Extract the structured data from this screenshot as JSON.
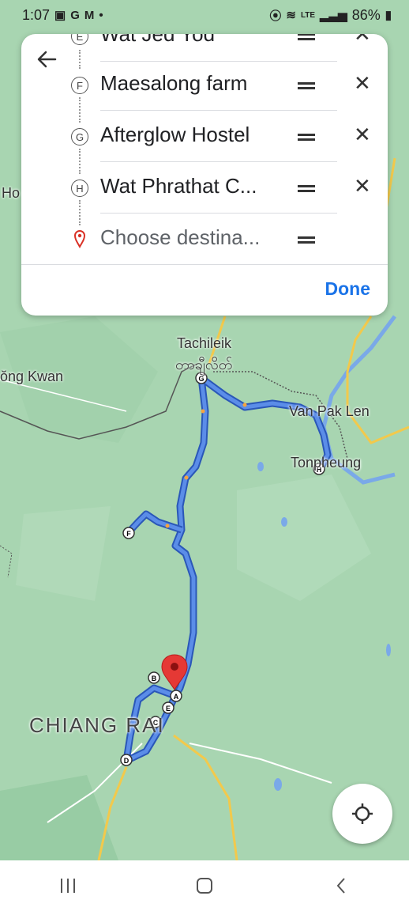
{
  "status_bar": {
    "time": "1:07",
    "battery": "86%",
    "network": "LTE"
  },
  "stops": [
    {
      "letter": "E",
      "name": "Wat Jed Yod",
      "remove": "✕"
    },
    {
      "letter": "F",
      "name": "Maesalong farm",
      "remove": "✕"
    },
    {
      "letter": "G",
      "name": "Afterglow Hostel",
      "remove": "✕"
    },
    {
      "letter": "H",
      "name": "Wat Phrathat C...",
      "remove": "✕"
    }
  ],
  "destination": {
    "placeholder": "Choose destina..."
  },
  "done_label": "Done",
  "map_labels": {
    "tachileik": "Tachileik",
    "tachileik_local": "တာချီလိတ်",
    "ong_kwan": "ŏng Kwan",
    "van_pak_len": "Van Pak Len",
    "tonpheung": "Tonpheung",
    "chiang_rai": "CHIANG RAI",
    "ho": "Ho"
  },
  "route_markers": [
    "A",
    "B",
    "C",
    "D",
    "E",
    "F",
    "G",
    "H"
  ],
  "colors": {
    "route": "#4a7fe0",
    "accent": "#1a73e8",
    "pin": "#e53935",
    "map": "#a8d5b1"
  }
}
